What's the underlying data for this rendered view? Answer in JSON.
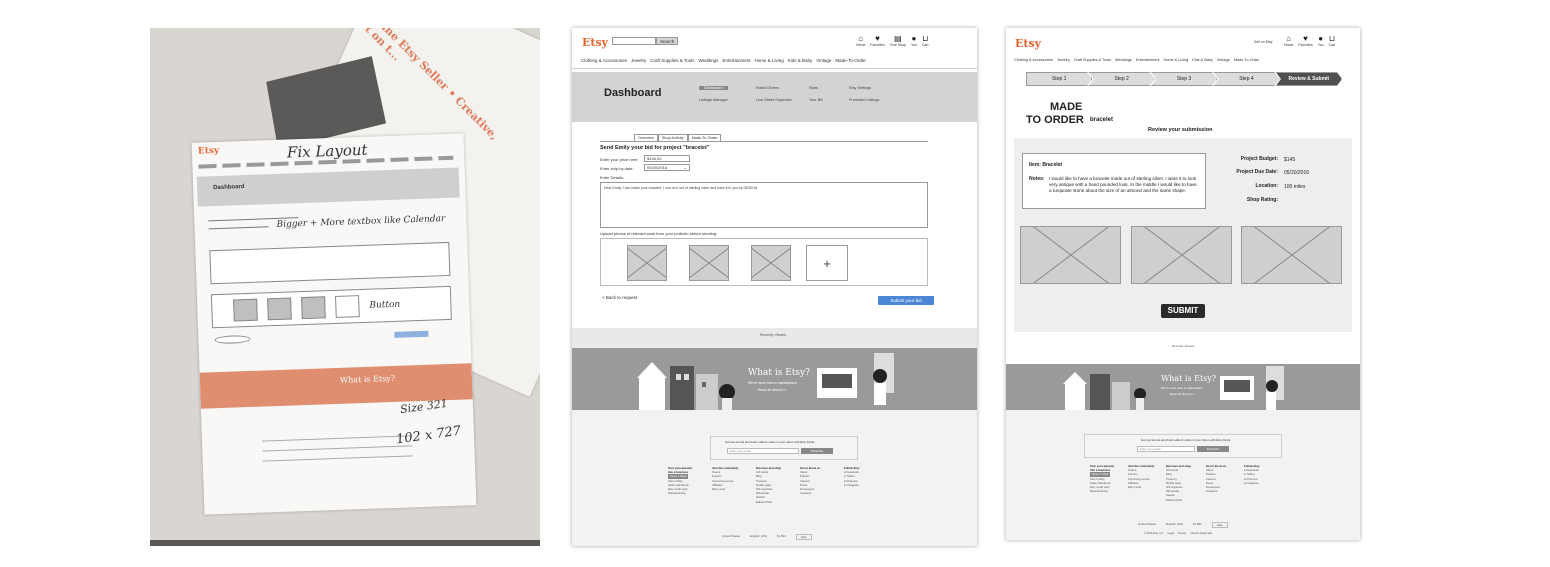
{
  "panel1": {
    "fix_note": "Fix Layout",
    "note_bigger": "Bigger + More textbox like Calendar",
    "note_button": "Button",
    "note_size1": "Size 321",
    "note_size2": "102 x 727",
    "dashboard_label": "Dashboard",
    "what_is_etsy": "What is Etsy?",
    "logo": "Etsy",
    "handwriting_top": "Christine  Etsy Seller • Creative, short on t..."
  },
  "panel2": {
    "logo": "Etsy",
    "search_btn": "Search",
    "header_icons": [
      {
        "icon": "home-icon",
        "glyph": "⌂",
        "label": "Home"
      },
      {
        "icon": "heart-icon",
        "glyph": "♥",
        "label": "Favorites"
      },
      {
        "icon": "shop-icon",
        "glyph": "▤",
        "label": "Your Shop"
      },
      {
        "icon": "user-icon",
        "glyph": "●",
        "label": "You"
      },
      {
        "icon": "cart-icon",
        "glyph": "⊔",
        "label": "Cart"
      }
    ],
    "cat_nav": [
      "Clothing & Accessories",
      "Jewelry",
      "Craft Supplies & Tools",
      "Weddings",
      "Entertainment",
      "Home & Living",
      "Kids & Baby",
      "Vintage",
      "Made-To-Order"
    ],
    "dashboard_title": "Dashboard",
    "dash_links": {
      "dashboard": "Dashboard",
      "listings_manager": "Listings Manager",
      "rated_orders": "Rated Orders",
      "live_sheet_organizer": "Live-Sheet Organizer",
      "stats": "Stats",
      "your_bill": "Your Bill",
      "etsy_settings": "Etsy Settings",
      "promoted_listings": "Promoted Listings"
    },
    "tabs": [
      "Overview",
      "Shop Activity",
      "Made-To-Order"
    ],
    "bid_title": "Send Emily your bid for project \"bracelet\"",
    "price_label": "Enter your price here:",
    "price_value": "$145.00",
    "ship_label": "Enter ship-by date:",
    "ship_value": "05/20/2016",
    "details_label": "Enter Details:",
    "details_text": "Dear Emily, I can make your bracelet. I can do it out of sterling silver and have it to you by 05/20/16.",
    "upload_label": "Upload photos of relevant work from your portfolio before sending:",
    "back_link": "< Back to request",
    "submit_btn": "Submit your bid",
    "recently_label": "Recently Viewed",
    "what_title": "What is Etsy?",
    "what_sub1": "We're more than a marketplace.",
    "what_sub2": "Read all about it »",
    "newsletter": "Get top trends and fresh editors' picks in your inbox with Etsy Finds",
    "email_placeholder": "Enter your email",
    "subscribe": "Subscribe",
    "footer_cols": [
      {
        "title": "Turn your passion into a business",
        "items": [
          "Open a Shop",
          "Sell on Etsy",
          "Seller Handbook",
          "Etsy credit card",
          "Manufacturing"
        ]
      },
      {
        "title": "Join the community",
        "items": [
          "Teams",
          "Forums",
          "Upcoming events",
          "Affiliates",
          "Etsy Local"
        ]
      },
      {
        "title": "Discover and shop",
        "items": [
          "Gift cards",
          "Blog",
          "Treasury",
          "Mobile apps",
          "Gift registries",
          "Wholesale",
          "Search",
          "Editors Picks"
        ]
      },
      {
        "title": "Get to know us",
        "items": [
          "About",
          "Policies",
          "Careers",
          "Press",
          "Developers",
          "Investors"
        ]
      },
      {
        "title": "Follow Etsy",
        "items": [
          "Facebook",
          "Twitter",
          "Pinterest",
          "Instagram"
        ]
      }
    ],
    "bottom_bar": [
      "United States",
      "English (US)",
      "$ USD",
      "Help"
    ]
  },
  "panel3": {
    "logo": "Etsy",
    "sell_on": "Sell on Etsy",
    "header_icons": [
      {
        "icon": "home-icon",
        "glyph": "⌂",
        "label": "Home"
      },
      {
        "icon": "heart-icon",
        "glyph": "♥",
        "label": "Favorites"
      },
      {
        "icon": "user-icon",
        "glyph": "●",
        "label": "You"
      },
      {
        "icon": "cart-icon",
        "glyph": "⊔",
        "label": "Cart"
      }
    ],
    "cat_nav": [
      "Clothing & Accessories",
      "Jewelry",
      "Craft Supplies & Tools",
      "Weddings",
      "Entertainment",
      "Home & Living",
      "Kids & Baby",
      "Vintage",
      "Made-To-Order"
    ],
    "steps": [
      "Step 1",
      "Step 2",
      "Step 3",
      "Step 4",
      "Review & Submit"
    ],
    "made1": "MADE",
    "made2": "TO ORDER",
    "bracelet": "bracelet",
    "review_label": "Review your submission",
    "item_label": "Item:",
    "item_value": "Bracelet",
    "notes_label": "Notes:",
    "notes_value": "I would like to have a bracelet made out of sterling silver. I want it to look very antique with a hand pounded look. In the middle I would like to have a turquoise stone about the size of an almond and the same shape.",
    "meta": [
      {
        "k": "Project Budget:",
        "v": "$145"
      },
      {
        "k": "Project Due Date:",
        "v": "05/20/2016"
      },
      {
        "k": "Location:",
        "v": "100 miles"
      },
      {
        "k": "Shop Rating:",
        "v": ""
      }
    ],
    "submit": "SUBMIT",
    "recently_label": "Recently Viewed",
    "what_title": "What is Etsy?",
    "what_sub1": "We're more than a marketplace.",
    "what_sub2": "Read all about it »",
    "newsletter": "Get top trends and fresh editors' picks in your inbox with Etsy Finds",
    "email_placeholder": "Enter your email",
    "subscribe": "Subscribe",
    "bottom_bar": [
      "United States",
      "English (US)",
      "$ USD",
      "Help"
    ],
    "copyright": [
      "© 2016 Etsy, Inc.",
      "Legal",
      "Privacy",
      "Interest-based ads"
    ]
  },
  "colors": {
    "etsy_orange": "#e5622c",
    "submit_blue": "#4b86d6",
    "banner_grey": "#9a9a9a",
    "dash_grey": "#d3d3d3"
  }
}
